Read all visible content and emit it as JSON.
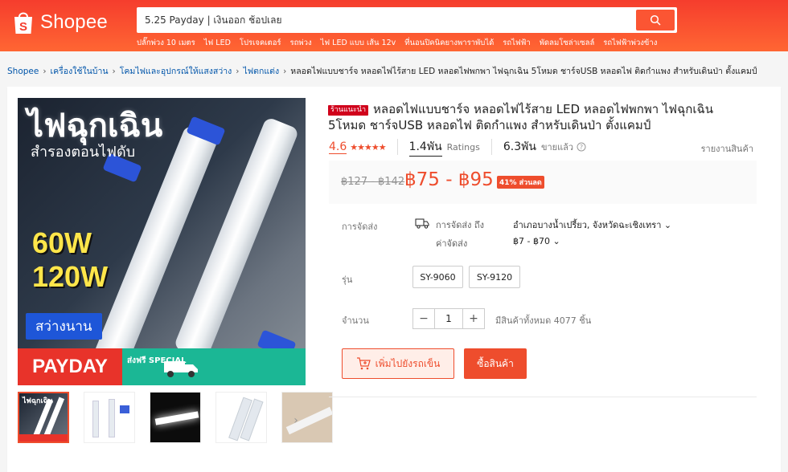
{
  "brand": {
    "name": "Shopee",
    "accent": "#ee4d2d",
    "header_gradient": [
      "#f53d2d",
      "#ff6633"
    ]
  },
  "search": {
    "value": "5.25 Payday | เงินออก ช้อปเลย",
    "button_icon": "search-icon"
  },
  "hotwords": [
    "ปลั๊กพ่วง 10 เมตร",
    "ไฟ LED",
    "โปรเจคเตอร์",
    "รถพ่วง",
    "ไฟ LED แบบ เส้น 12v",
    "ที่นอนปิคนิคยางพาราพับได้",
    "รถไฟฟ้า",
    "พัดลมโซล่าเซลล์",
    "รถไฟฟ้าพ่วงข้าง"
  ],
  "breadcrumb": [
    "Shopee",
    "เครื่องใช้ในบ้าน",
    "โคมไฟและอุปกรณ์ให้แสงสว่าง",
    "ไฟตกแต่ง"
  ],
  "breadcrumb_current": "หลอดไฟแบบชาร์จ หลอดไฟไร้สาย LED หลอดไฟพกพา ไฟฉุกเฉิน 5โหมด ชาร์จUSB หลอดไฟ ติดกำแพง สำหรับเดินป่า ตั้งแคมป์",
  "gallery": {
    "main_image_text": {
      "title": "ไฟฉุกเฉิน",
      "subtitle": "สำรองตอนไฟดับ",
      "watt1": "60W",
      "watt2": "120W",
      "bright": "สว่างนาน",
      "payday": "PAYDAY",
      "free_ship": "ส่งฟรี SPECIAL"
    },
    "thumbnails_count": 5,
    "next_icon": "chevron-right-icon"
  },
  "product": {
    "badge": "ร้านแนะนำ",
    "title": "หลอดไฟแบบชาร์จ หลอดไฟไร้สาย LED หลอดไฟพกพา ไฟฉุกเฉิน 5โหมด ชาร์จUSB หลอดไฟ ติดกำแพง สำหรับเดินป่า ตั้งแคมป์",
    "rating": "4.6",
    "stars": 4.6,
    "ratings_count": "1.4พัน",
    "ratings_label": "Ratings",
    "sold_count": "6.3พัน",
    "sold_label": "ขายแล้ว",
    "report": "รายงานสินค้า",
    "original_price": "฿127 - ฿142",
    "price": "฿75 - ฿95",
    "discount": "41% ส่วนลด"
  },
  "shipping": {
    "label": "การจัดส่ง",
    "to_label": "การจัดส่ง ถึง",
    "to_value": "อำเภอบางน้ำเปรี้ยว, จังหวัดฉะเชิงเทรา",
    "fee_label": "ค่าจัดส่ง",
    "fee_value": "฿7 - ฿70"
  },
  "variants": {
    "label": "รุ่น",
    "options": [
      "SY-9060",
      "SY-9120"
    ]
  },
  "quantity": {
    "label": "จำนวน",
    "value": "1",
    "minus": "−",
    "plus": "+",
    "stock": "มีสินค้าทั้งหมด 4077 ชิ้น"
  },
  "actions": {
    "add_to_cart": "เพิ่มไปยังรถเข็น",
    "buy_now": "ซื้อสินค้า"
  }
}
